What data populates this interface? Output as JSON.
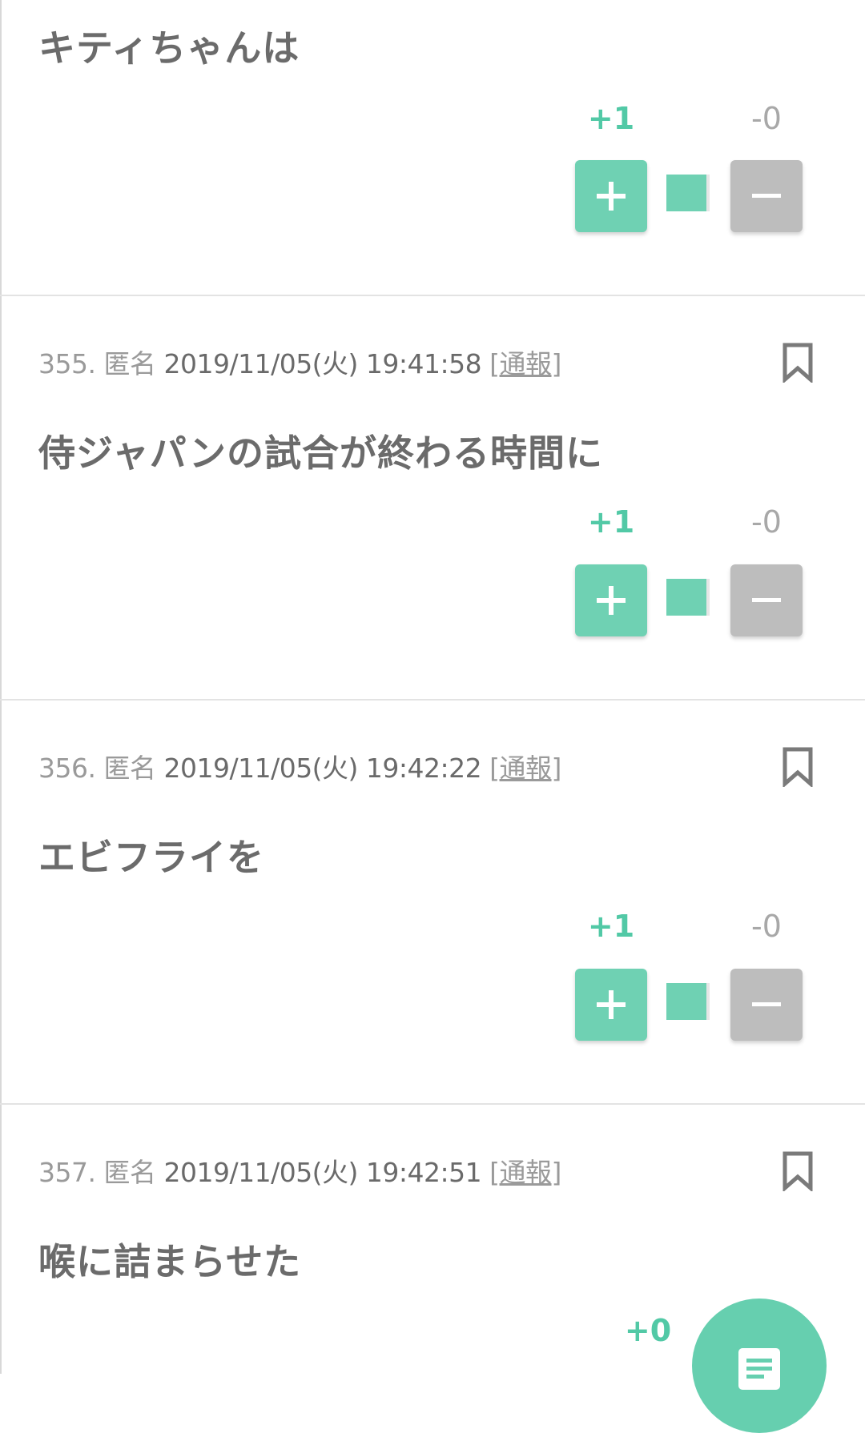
{
  "posts": [
    {
      "number": "",
      "name": "",
      "date": "",
      "report": "",
      "text": "キティちゃんは",
      "plus": "+1",
      "minus": "-0",
      "plus_ratio": 1.0
    },
    {
      "number": "355.",
      "name": "匿名",
      "date": "2019/11/05(火) 19:41:58",
      "report": "通報",
      "text": "侍ジャパンの試合が終わる時間に",
      "plus": "+1",
      "minus": "-0",
      "plus_ratio": 1.0
    },
    {
      "number": "356.",
      "name": "匿名",
      "date": "2019/11/05(火) 19:42:22",
      "report": "通報",
      "text": "エビフライを",
      "plus": "+1",
      "minus": "-0",
      "plus_ratio": 1.0
    },
    {
      "number": "357.",
      "name": "匿名",
      "date": "2019/11/05(火) 19:42:51",
      "report": "通報",
      "text": "喉に詰まらせた",
      "plus": "+0",
      "minus": "",
      "plus_ratio": 0
    }
  ],
  "icons": {
    "bookmark": "bookmark-icon",
    "plus": "plus-icon",
    "minus": "minus-icon",
    "fab": "comment-list-icon"
  },
  "colors": {
    "accent": "#6fd1b3",
    "plus_text": "#52c9a6",
    "minus_button": "#bdbdbd"
  }
}
